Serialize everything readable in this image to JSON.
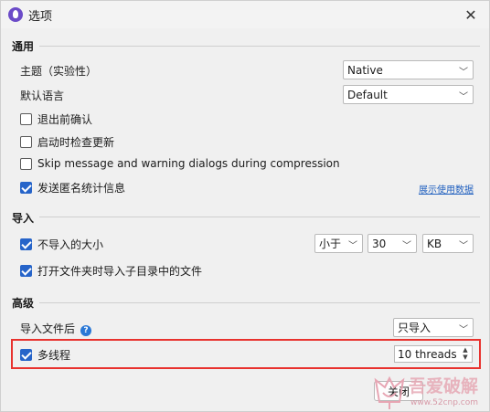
{
  "window": {
    "title": "选项",
    "close_glyph": "✕"
  },
  "general": {
    "section_title": "通用",
    "theme_label": "主题（实验性）",
    "theme_value": "Native",
    "language_label": "默认语言",
    "language_value": "Default",
    "confirm_exit_label": "退出前确认",
    "confirm_exit_checked": false,
    "check_updates_label": "启动时检查更新",
    "check_updates_checked": false,
    "skip_dialogs_label": "Skip message and warning dialogs during compression",
    "skip_dialogs_checked": false,
    "send_stats_label": "发送匿名统计信息",
    "send_stats_checked": true,
    "show_data_link": "展示使用数据"
  },
  "import": {
    "section_title": "导入",
    "skip_size_label": "不导入的大小",
    "skip_size_checked": true,
    "comparator_value": "小于",
    "size_value": "30",
    "unit_value": "KB",
    "subfolders_label": "打开文件夹时导入子目录中的文件",
    "subfolders_checked": true
  },
  "advanced": {
    "section_title": "高级",
    "after_import_label": "导入文件后",
    "after_import_value": "只导入",
    "help_glyph": "?",
    "multithread_label": "多线程",
    "multithread_checked": true,
    "threads_value": "10 threads"
  },
  "footer": {
    "close_label": "关闭"
  },
  "watermark": {
    "text": "吾爱破解",
    "url": "www.52cnp.com"
  },
  "colors": {
    "accent": "#2664c9",
    "highlight": "#e8322e",
    "link": "#1f5fbf"
  }
}
